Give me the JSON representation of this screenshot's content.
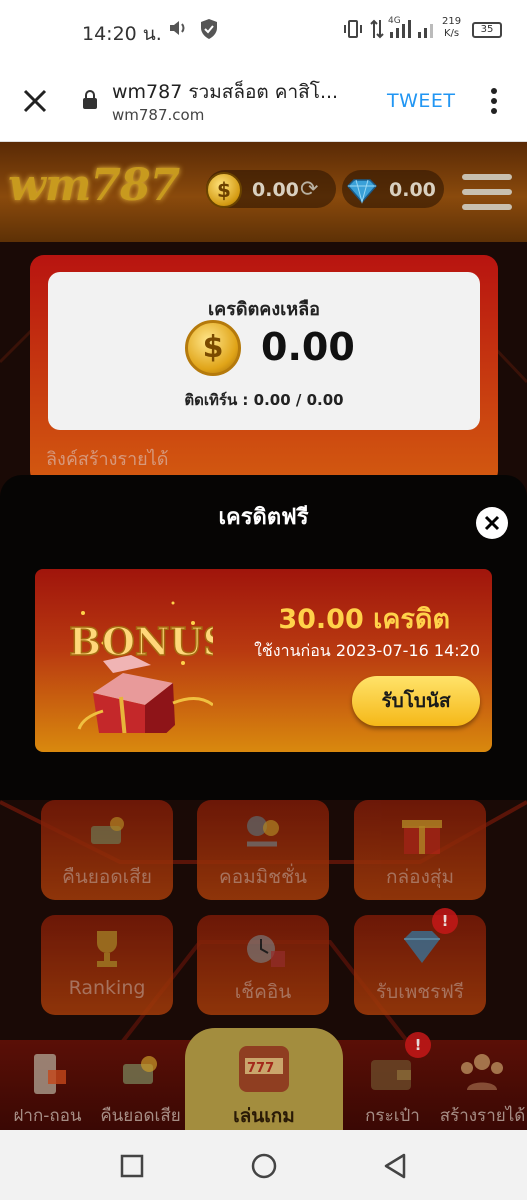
{
  "status_bar": {
    "time": "14:20 น.",
    "net_speed_value": "219",
    "net_speed_unit": "K/s",
    "network_label": "4G",
    "battery": "35"
  },
  "browser": {
    "page_title": "wm787 รวมสล็อต คาสิโ...",
    "url": "wm787.com",
    "tweet_label": "TWEET"
  },
  "header": {
    "logo_text": "wm787",
    "coin_balance": "0.00",
    "gem_balance": "0.00"
  },
  "credit_card": {
    "title": "เครดิตคงเหลือ",
    "value": "0.00",
    "turnover": "ติดเทิร์น : 0.00 / 0.00"
  },
  "earn_link": "ลิงค์สร้างรายได้",
  "modal": {
    "title": "เครดิตฟรี",
    "bonus_word": "BONUS",
    "bonus_amount": "30.00 เครดิต",
    "expire_text": "ใช้งานก่อน 2023-07-16 14:20",
    "claim_label": "รับโบนัส"
  },
  "grid": {
    "items": [
      {
        "label": "คืนยอดเสีย"
      },
      {
        "label": "คอมมิชชั่น"
      },
      {
        "label": "กล่องสุ่ม"
      },
      {
        "label": "Ranking"
      },
      {
        "label": "เช็คอิน"
      },
      {
        "label": "รับเพชรฟรี",
        "badge": "!"
      }
    ]
  },
  "bottom_nav": {
    "items": [
      {
        "label": "ฝาก-ถอน"
      },
      {
        "label": "คืนยอดเสีย"
      },
      {
        "label": "เล่นเกม"
      },
      {
        "label": "กระเป๋า",
        "badge": "!"
      },
      {
        "label": "สร้างรายได้"
      }
    ]
  },
  "colors": {
    "accent_gold": "#f5b818",
    "primary_red": "#b81410",
    "link_blue": "#2196f3"
  }
}
